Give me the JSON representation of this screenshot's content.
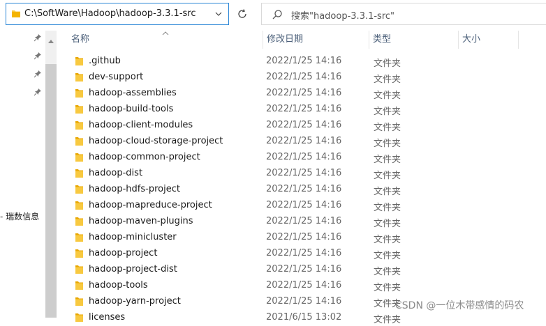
{
  "address_bar": {
    "path": "C:\\SoftWare\\Hadoop\\hadoop-3.3.1-src"
  },
  "search": {
    "placeholder": "搜索\"hadoop-3.3.1-src\""
  },
  "nav_pane": {
    "partial_label": "- 瑞数信息"
  },
  "columns": {
    "name": "名称",
    "date": "修改日期",
    "type": "类型",
    "size": "大小"
  },
  "files": [
    {
      "name": ".github",
      "date": "2022/1/25 14:16",
      "type": "文件夹"
    },
    {
      "name": "dev-support",
      "date": "2022/1/25 14:16",
      "type": "文件夹"
    },
    {
      "name": "hadoop-assemblies",
      "date": "2022/1/25 14:16",
      "type": "文件夹"
    },
    {
      "name": "hadoop-build-tools",
      "date": "2022/1/25 14:16",
      "type": "文件夹"
    },
    {
      "name": "hadoop-client-modules",
      "date": "2022/1/25 14:16",
      "type": "文件夹"
    },
    {
      "name": "hadoop-cloud-storage-project",
      "date": "2022/1/25 14:16",
      "type": "文件夹"
    },
    {
      "name": "hadoop-common-project",
      "date": "2022/1/25 14:16",
      "type": "文件夹"
    },
    {
      "name": "hadoop-dist",
      "date": "2022/1/25 14:16",
      "type": "文件夹"
    },
    {
      "name": "hadoop-hdfs-project",
      "date": "2022/1/25 14:16",
      "type": "文件夹"
    },
    {
      "name": "hadoop-mapreduce-project",
      "date": "2022/1/25 14:16",
      "type": "文件夹"
    },
    {
      "name": "hadoop-maven-plugins",
      "date": "2022/1/25 14:16",
      "type": "文件夹"
    },
    {
      "name": "hadoop-minicluster",
      "date": "2022/1/25 14:16",
      "type": "文件夹"
    },
    {
      "name": "hadoop-project",
      "date": "2022/1/25 14:16",
      "type": "文件夹"
    },
    {
      "name": "hadoop-project-dist",
      "date": "2022/1/25 14:16",
      "type": "文件夹"
    },
    {
      "name": "hadoop-tools",
      "date": "2022/1/25 14:16",
      "type": "文件夹"
    },
    {
      "name": "hadoop-yarn-project",
      "date": "2022/1/25 14:16",
      "type": "文件夹"
    },
    {
      "name": "licenses",
      "date": "2021/6/15 13:02",
      "type": "文件夹"
    }
  ],
  "watermark": "CSDN @一位木带感情的码农",
  "colors": {
    "folder": "#f8c940",
    "focus_border": "#2a86d6",
    "header_text": "#4c607a"
  }
}
